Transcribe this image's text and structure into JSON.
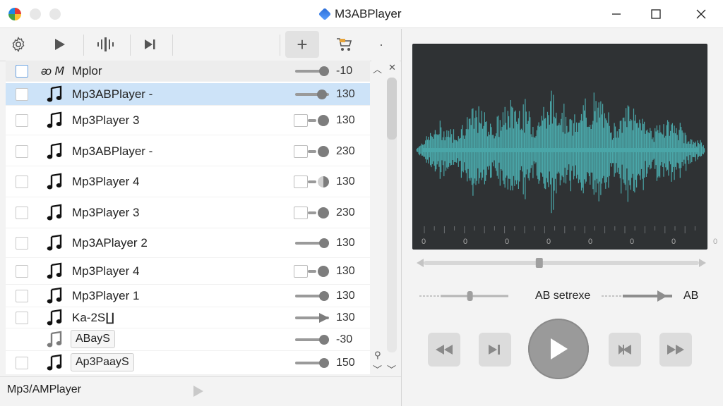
{
  "window": {
    "title": "M3ABPlayer"
  },
  "toolbar": {
    "items": [
      "settings-icon",
      "play-icon",
      "waveform-icon",
      "skip-next-icon",
      "add-icon",
      "cart-icon",
      "more-icon"
    ],
    "add_label": "+",
    "more_label": "·"
  },
  "list": {
    "header": {
      "name": "Mplor",
      "prefix": "ᴔ Ⅿ",
      "value": "-10",
      "level": 0.85
    },
    "rows": [
      {
        "name": "Mp3ABPlayer -",
        "value": "130",
        "control": "slider",
        "level": 0.8,
        "selected": true
      },
      {
        "name": "Mp3Player 3",
        "value": "130",
        "control": "box",
        "level": 0.5
      },
      {
        "name": "Mp3ABPlayer -",
        "value": "230",
        "control": "box",
        "level": 0.5
      },
      {
        "name": "Mp3Player 4",
        "value": "130",
        "control": "box-half",
        "level": 0.5
      },
      {
        "name": "Mp3Player 3",
        "value": "230",
        "control": "box",
        "level": 0.5
      },
      {
        "name": "Mp3APlayer 2",
        "value": "130",
        "control": "slider",
        "level": 0.85
      },
      {
        "name": "Mp3Player 4",
        "value": "130",
        "control": "box",
        "level": 0.5
      },
      {
        "name": "Mp3Player 1",
        "value": "130",
        "control": "slider",
        "level": 0.85
      },
      {
        "name": "Ka-2S∐",
        "value": "130",
        "control": "arrow",
        "level": 0.85
      },
      {
        "name": "ABayS",
        "value": "-30",
        "control": "slider",
        "level": 0.85,
        "tagged": true,
        "no_checkbox": true
      },
      {
        "name": "Ap3PaayS",
        "value": "150",
        "control": "slider",
        "level": 0.85,
        "tagged": true
      }
    ]
  },
  "status": {
    "text": "Mp3/AMPlayer"
  },
  "waveform": {
    "tick_labels": [
      "0",
      "0",
      "0",
      "0",
      "0",
      "0",
      "0",
      "0"
    ],
    "seek_position": 0.42
  },
  "ab_section": {
    "left_slider_level": 0.6,
    "label": "AB setrexe",
    "right_slider_level": 0.9,
    "right_label": "AB"
  },
  "controls": [
    "rewind-icon",
    "skip-next-icon",
    "play-icon",
    "skip-back-icon",
    "fast-forward-icon"
  ],
  "colors": {
    "wave": "#4aa6a8",
    "wave_bg": "#2f3234",
    "selected_row": "#cde3f8"
  }
}
